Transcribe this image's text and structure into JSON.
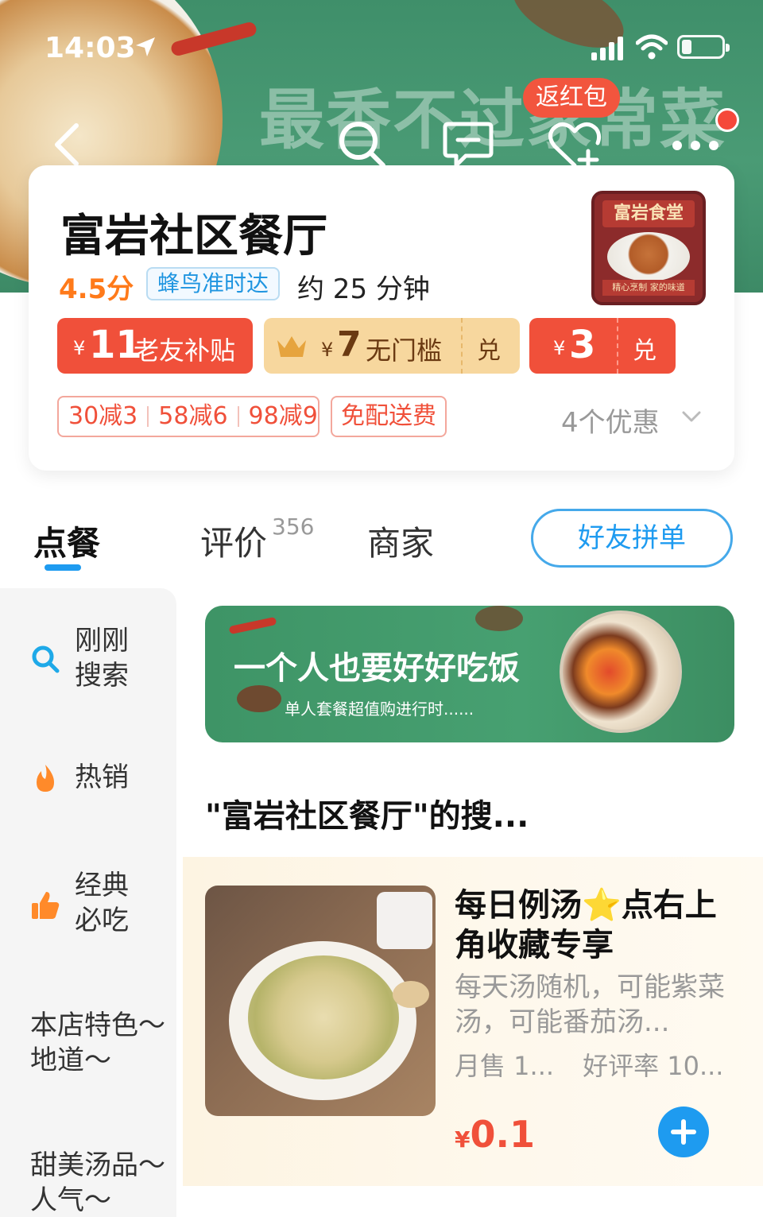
{
  "status_bar": {
    "time": "14:03"
  },
  "header": {
    "slogan": "最香不过家常菜",
    "red_packet": "返红包",
    "icons": [
      "back-icon",
      "search-icon",
      "message-icon",
      "favorite-icon",
      "more-icon"
    ]
  },
  "shop": {
    "name": "富岩社区餐厅",
    "rating": "4.5分",
    "ontime_badge": "蜂鸟准时达",
    "eta": "约 25 分钟",
    "logo_text": "富岩食堂",
    "logo_caption": "精心烹制 家的味道"
  },
  "coupons": [
    {
      "currency": "¥",
      "amount": "11",
      "label": "老友补贴"
    },
    {
      "currency": "¥",
      "amount": "7",
      "label": "无门槛",
      "action": "兑"
    },
    {
      "currency": "¥",
      "amount": "3",
      "action": "兑"
    }
  ],
  "promotions": {
    "discounts": [
      "30减3",
      "58减6",
      "98减9"
    ],
    "free_delivery": "免配送费",
    "more": "4个优惠"
  },
  "tabs": {
    "order": "点餐",
    "reviews": "评价",
    "reviews_count": "356",
    "merchant": "商家",
    "group_order": "好友拼单"
  },
  "sidebar": {
    "items": [
      {
        "label": "刚刚搜索",
        "icon": "search-icon"
      },
      {
        "label": "热销",
        "icon": "flame-icon"
      },
      {
        "label": "经典必吃",
        "icon": "thumbs-up-icon"
      },
      {
        "label": "本店特色～地道～"
      },
      {
        "label": "甜美汤品～人气～"
      }
    ]
  },
  "banner": {
    "title": "一个人也要好好吃饭",
    "subtitle": "单人套餐超值购进行时......"
  },
  "section_title": "\"富岩社区餐厅\"的搜...",
  "product": {
    "title_part1": "每日例汤",
    "star": "⭐",
    "title_part2": "点右上角收藏专享",
    "description": "每天汤随机，可能紫菜汤，可能番茄汤...",
    "sales": "月售 1...",
    "rating": "好评率 10...",
    "currency": "¥",
    "price": "0.1"
  },
  "colors": {
    "accent_blue": "#1e9bf0",
    "coupon_red": "#f0503a",
    "rating_orange": "#ff7a1a",
    "header_green": "#4a9b75"
  }
}
